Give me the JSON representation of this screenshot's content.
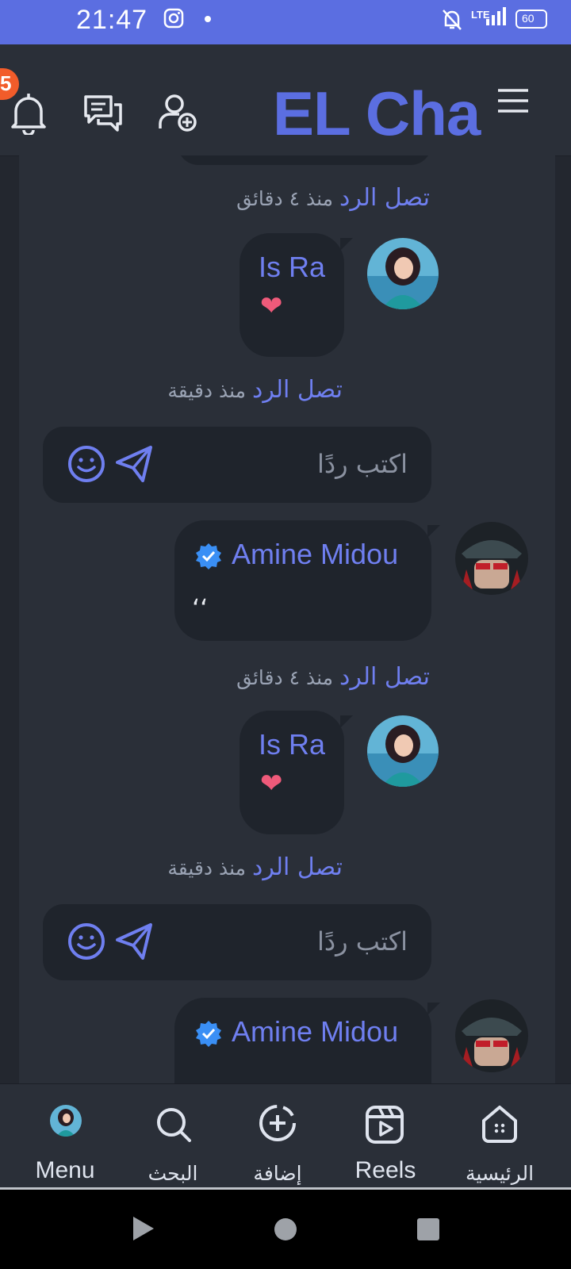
{
  "status_bar": {
    "time": "21:47",
    "battery": "60",
    "network": "LTE"
  },
  "header": {
    "brand": "EL Cha",
    "notification_count": "5"
  },
  "feed": {
    "reply_link": "تصل الرد",
    "time_4min": "منذ ٤ دقائق",
    "time_1min": "منذ دقيقة",
    "reply_placeholder": "اكتب ردًا",
    "user_israa": "Is Ra",
    "user_amine": "Amine Midou",
    "amine_comment": "‘‘",
    "heart_emoji": "❤"
  },
  "bottom_nav": {
    "items": [
      {
        "label": "Menu",
        "icon": "avatar"
      },
      {
        "label": "البحث",
        "icon": "search-icon"
      },
      {
        "label": "إضافة",
        "icon": "add-circle-icon"
      },
      {
        "label": "Reels",
        "icon": "reels-icon"
      },
      {
        "label": "الرئيسية",
        "icon": "home-icon"
      }
    ]
  },
  "colors": {
    "accent": "#5b6ee1",
    "badge": "#f25c2a",
    "background": "#23272f",
    "panel": "#2a2f38",
    "bubble": "#1f242c"
  }
}
